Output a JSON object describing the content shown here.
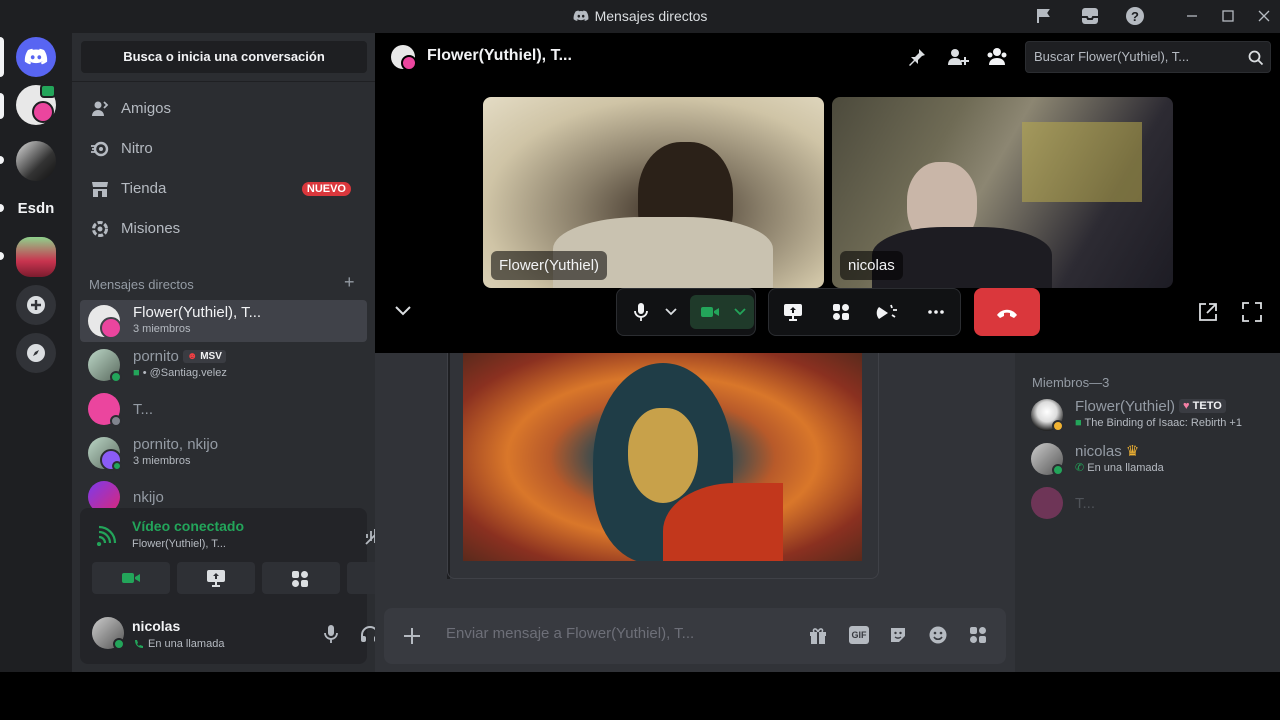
{
  "window": {
    "title": "Mensajes directos"
  },
  "rail": {
    "server_label": "Esdn"
  },
  "sidebar": {
    "search_button": "Busca o inicia una conversación",
    "nav": [
      {
        "label": "Amigos"
      },
      {
        "label": "Nitro"
      },
      {
        "label": "Tienda",
        "badge": "NUEVO"
      },
      {
        "label": "Misiones"
      }
    ],
    "dm_header": "Mensajes directos",
    "dms": [
      {
        "name": "Flower(Yuthiel), T...",
        "sub": "3 miembros"
      },
      {
        "name": "pornito",
        "tag": "MSV",
        "sub": "• @Santiag.velez"
      },
      {
        "name": "T...",
        "sub": ""
      },
      {
        "name": "pornito, nkijo",
        "sub": "3 miembros"
      },
      {
        "name": "nkijo",
        "sub": ""
      }
    ]
  },
  "voice": {
    "title": "Vídeo conectado",
    "subtitle": "Flower(Yuthiel), T..."
  },
  "user": {
    "name": "nicolas",
    "status": "En una llamada"
  },
  "header": {
    "title": "Flower(Yuthiel), T...",
    "search_placeholder": "Buscar Flower(Yuthiel), T..."
  },
  "call": {
    "tiles": [
      {
        "name": "Flower(Yuthiel)"
      },
      {
        "name": "nicolas"
      }
    ]
  },
  "chat": {
    "composer_placeholder": "Enviar mensaje a Flower(Yuthiel), T...",
    "gif_label": "GIF"
  },
  "members": {
    "header": "Miembros—3",
    "list": [
      {
        "name": "Flower(Yuthiel)",
        "tag": "TETO",
        "activity": "The Binding of Isaac: Rebirth +1"
      },
      {
        "name": "nicolas",
        "activity": "En una llamada"
      },
      {
        "name": "T...",
        "activity": ""
      }
    ]
  },
  "colors": {
    "accent": "#5865f2",
    "online": "#23a55a",
    "danger": "#da373c",
    "end_call": "#da373c"
  }
}
